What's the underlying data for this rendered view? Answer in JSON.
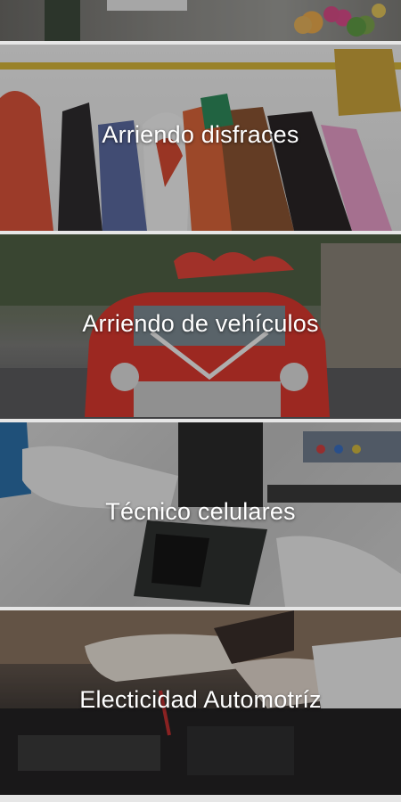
{
  "services": [
    {
      "label": ""
    },
    {
      "label": "Arriendo disfraces"
    },
    {
      "label": "Arriendo de vehículos"
    },
    {
      "label": "Técnico celulares"
    },
    {
      "label": "Electicidad Automotríz"
    }
  ]
}
